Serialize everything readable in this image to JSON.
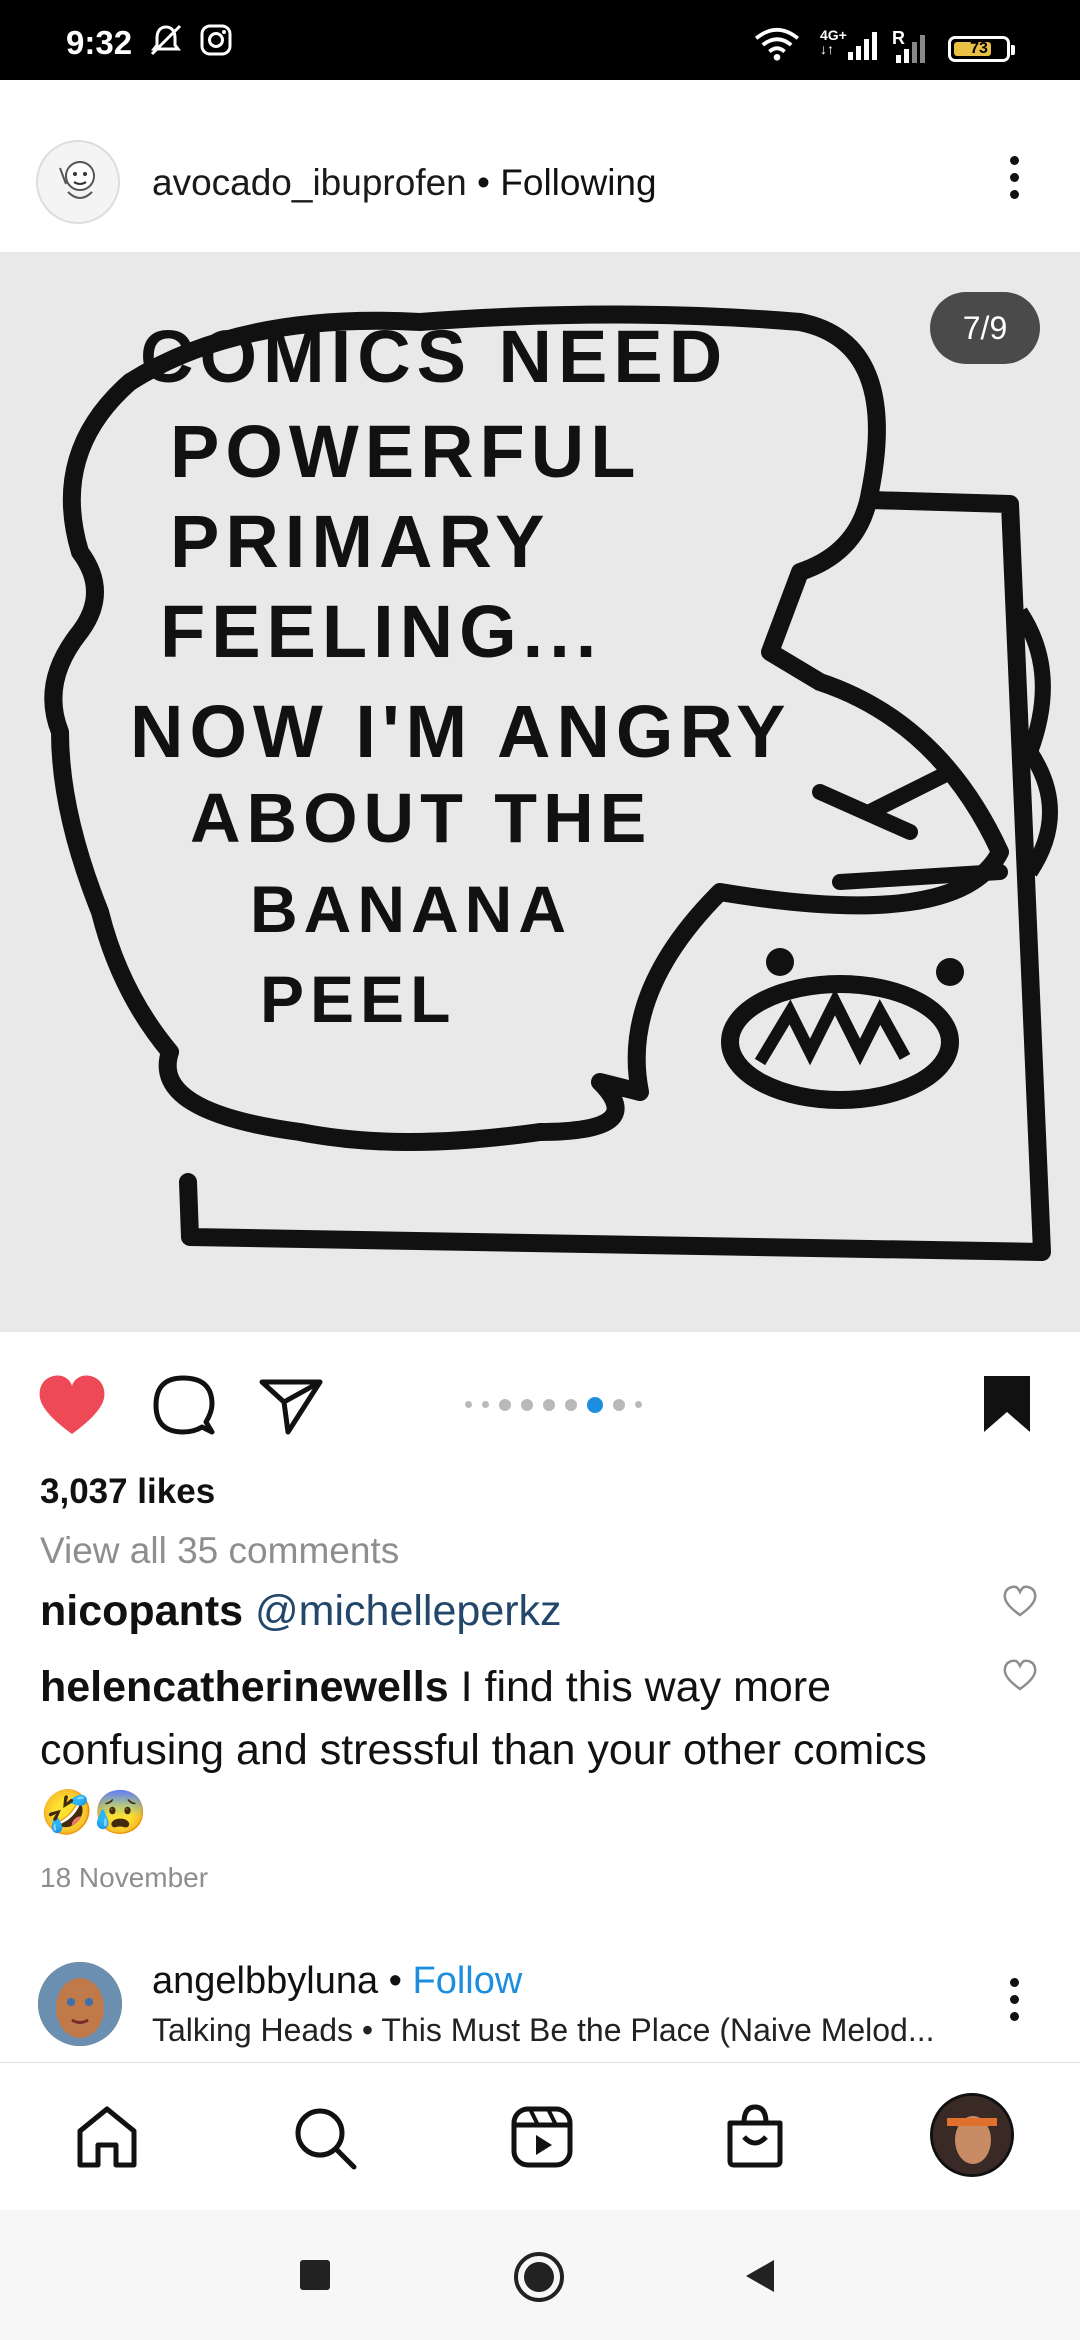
{
  "status_bar": {
    "time": "9:32",
    "network": "4G+",
    "network_sub": "↓↑",
    "roaming": "R",
    "battery": "73",
    "battery_level": 0.73,
    "icons": [
      "mute-bell-icon",
      "instagram-icon",
      "wifi-icon",
      "signal-icon",
      "signal-icon",
      "battery-icon"
    ]
  },
  "post": {
    "username": "avocado_ibuprofen",
    "follow_status": "• Following",
    "image_counter": "7/9",
    "comic_lines": [
      "COMICS NEED",
      "POWERFUL",
      "PRIMARY",
      "FEELING...",
      "NOW I'M ANGRY",
      "ABOUT THE",
      "BANANA",
      "PEEL"
    ],
    "carousel": {
      "total": 9,
      "active_index": 6
    },
    "likes": "3,037 likes",
    "view_comments": "View all 35 comments",
    "comments": [
      {
        "user": "nicopants",
        "text": "@michelleperkz",
        "is_mention": true
      },
      {
        "user": "helencatherinewells",
        "text": "I find this way more confusing and stressful than your other comics",
        "emoji": "🤣😰"
      }
    ],
    "date": "18 November"
  },
  "next_post": {
    "username": "angelbbyluna",
    "follow_label": "Follow",
    "separator": " • ",
    "audio": "Talking Heads • This Must Be the Place (Naive Melod..."
  },
  "colors": {
    "like_red": "#ed4956",
    "follow_blue": "#1d8de0",
    "mention_blue": "#23476b",
    "carousel_active": "#1d8de0"
  },
  "tabs": [
    "home-icon",
    "search-icon",
    "reels-icon",
    "shop-icon",
    "profile-avatar"
  ],
  "nav": [
    "recents-button",
    "home-button",
    "back-button"
  ]
}
